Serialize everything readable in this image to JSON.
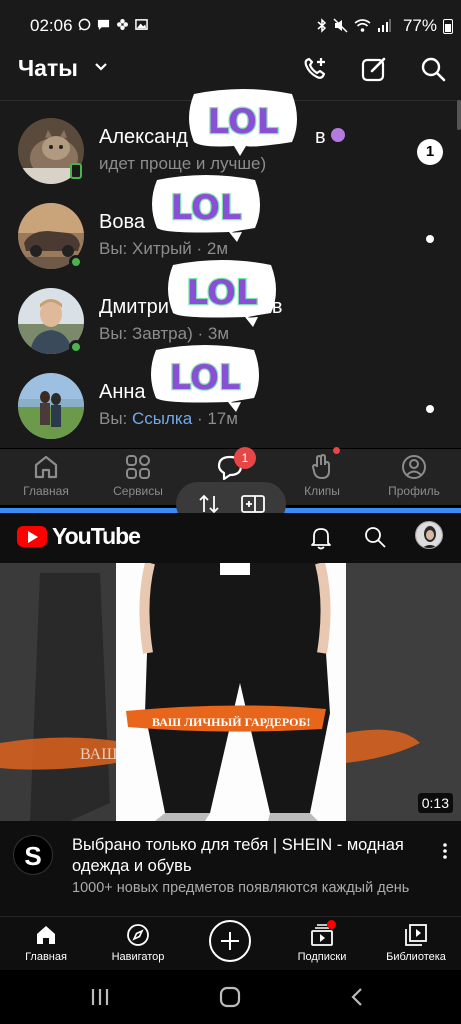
{
  "status_bar": {
    "time": "02:06",
    "battery": "77%",
    "left_icons": [
      "whatsapp-icon",
      "chat-icon",
      "pinwheel-icon",
      "gallery-icon"
    ],
    "right_icons": [
      "bluetooth-icon",
      "mute-icon",
      "wifi-icon",
      "signal-icon",
      "battery-icon"
    ]
  },
  "vk": {
    "title": "Чаты",
    "header_buttons": [
      "add-call-icon",
      "compose-icon",
      "search-icon"
    ],
    "chats": [
      {
        "name": "Александ",
        "name_tail": "в",
        "preview": "идет проще и лучше)",
        "unread": "1",
        "status": "mobile"
      },
      {
        "name": "Вова",
        "preview_prefix": "Вы: Хитрый",
        "time": "· 2м",
        "status": "online"
      },
      {
        "name": "Дмитри",
        "name_tail": "в",
        "preview_prefix": "Вы: Завтра)",
        "time": "· 3м",
        "status": "online"
      },
      {
        "name": "Анна",
        "preview_prefix": "Вы:",
        "preview_link": "Ссылка",
        "time": "· 17м",
        "status": "none"
      }
    ],
    "sticker_text": "LOL",
    "tabs": [
      {
        "label": "Главная",
        "icon": "home-icon"
      },
      {
        "label": "Сервисы",
        "icon": "services-icon"
      },
      {
        "label": "",
        "icon": "messages-icon",
        "badge": "1"
      },
      {
        "label": "Клипы",
        "icon": "clips-icon"
      },
      {
        "label": "Профиль",
        "icon": "profile-icon"
      }
    ]
  },
  "split_controls": [
    "swap-icon",
    "split-view-icon"
  ],
  "youtube": {
    "wordmark": "YouTube",
    "header_buttons": [
      "bell-icon",
      "search-icon",
      "avatar"
    ],
    "video": {
      "duration": "0:13",
      "banner": "ВАШ ЛИЧНЫЙ ГАРДЕРОБ!",
      "channel_initial": "S",
      "title": "Выбрано только для тебя | SHEIN - модная одежда и обувь",
      "subtitle": "1000+ новых предметов появляются каждый день"
    },
    "nav": [
      {
        "label": "Главная",
        "icon": "home-filled-icon"
      },
      {
        "label": "Навигатор",
        "icon": "compass-icon"
      },
      {
        "label": "",
        "icon": "create-icon"
      },
      {
        "label": "Подписки",
        "icon": "subscriptions-icon"
      },
      {
        "label": "Библиотека",
        "icon": "library-icon"
      }
    ]
  },
  "android_nav": [
    "recents-icon",
    "home-icon",
    "back-icon"
  ],
  "colors": {
    "vk_bg": "#1a1a1a",
    "vk_link": "#71aaeb",
    "online": "#4bb34b",
    "badge_red": "#e64646",
    "split_blue": "#3d8bf5",
    "yt_red": "#ff0000",
    "sticker_purple": "#8b4fd6",
    "sticker_green": "#7fe3b0"
  }
}
